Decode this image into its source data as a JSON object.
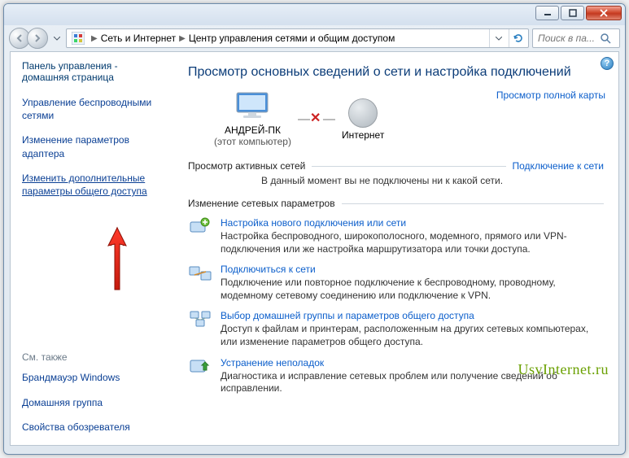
{
  "titlebar": {},
  "breadcrumb": {
    "part1": "Сеть и Интернет",
    "part2": "Центр управления сетями и общим доступом"
  },
  "search": {
    "placeholder": "Поиск в па..."
  },
  "sidebar": {
    "home": "Панель управления - домашняя страница",
    "items": [
      "Управление беспроводными сетями",
      "Изменение параметров адаптера",
      "Изменить дополнительные параметры общего доступа"
    ],
    "see_also_label": "См. также",
    "see_also": [
      "Брандмауэр Windows",
      "Домашняя группа",
      "Свойства обозревателя"
    ]
  },
  "main": {
    "heading": "Просмотр основных сведений о сети и настройка подключений",
    "full_map": "Просмотр полной карты",
    "node1": {
      "title": "АНДРЕЙ-ПК",
      "sub": "(этот компьютер)"
    },
    "node2": {
      "title": "Интернет"
    },
    "active_networks_label": "Просмотр активных сетей",
    "connect_to_network": "Подключение к сети",
    "not_connected_msg": "В данный момент вы не подключены ни к какой сети.",
    "change_settings_label": "Изменение сетевых параметров",
    "tasks": [
      {
        "title": "Настройка нового подключения или сети",
        "desc": "Настройка беспроводного, широкополосного, модемного, прямого или VPN-подключения или же настройка маршрутизатора или точки доступа."
      },
      {
        "title": "Подключиться к сети",
        "desc": "Подключение или повторное подключение к беспроводному, проводному, модемному сетевому соединению или подключение к VPN."
      },
      {
        "title": "Выбор домашней группы и параметров общего доступа",
        "desc": "Доступ к файлам и принтерам, расположенным на других сетевых компьютерах, или изменение параметров общего доступа."
      },
      {
        "title": "Устранение неполадок",
        "desc": "Диагностика и исправление сетевых проблем или получение сведений об исправлении."
      }
    ]
  },
  "watermark": "UsvInternet.ru"
}
